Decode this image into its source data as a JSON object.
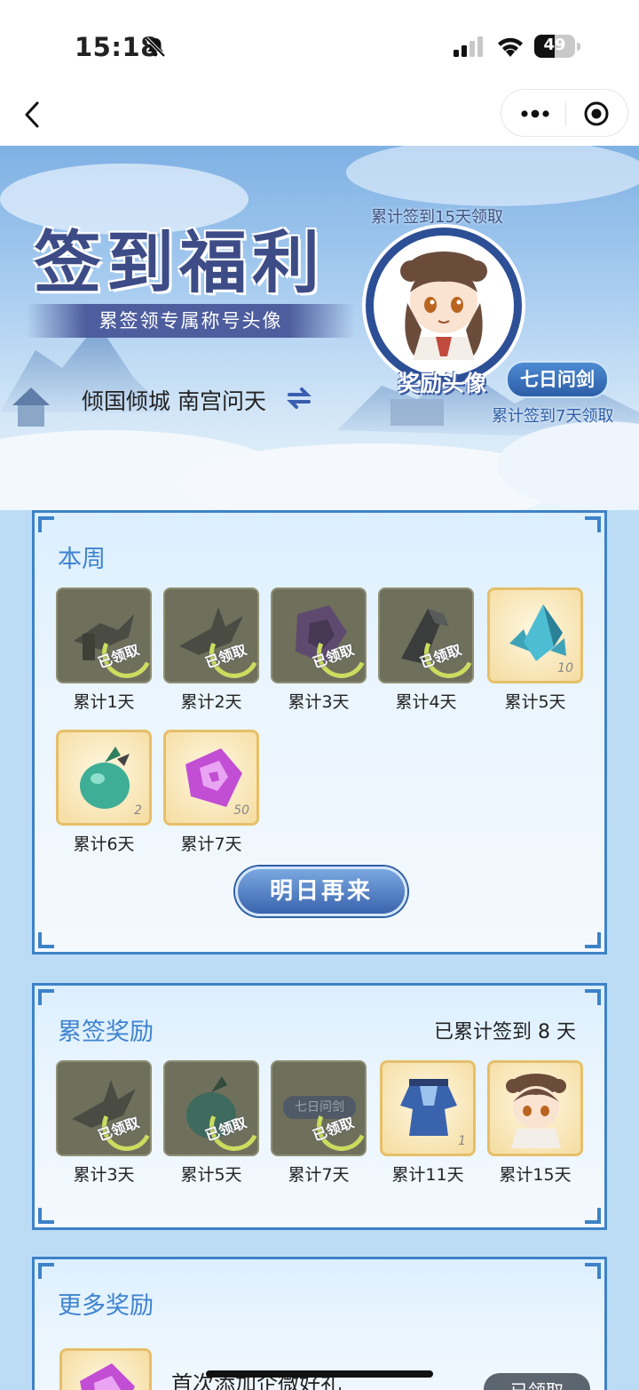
{
  "status_bar": {
    "time": "15:18",
    "battery": "49",
    "battery_level": 0.49
  },
  "hero": {
    "title": "签到福利",
    "subtitle": "累签领专属称号头像",
    "user_titles": "倾国倾城 南宫问天",
    "avatar_caption": "累计签到15天领取",
    "avatar_label": "奖励头像",
    "badge_label": "七日问剑",
    "badge_caption": "累计签到7天领取"
  },
  "weekly": {
    "title": "本周",
    "items": [
      {
        "label": "累计1天",
        "status": "已领取",
        "icon": "sword-hilt-icon"
      },
      {
        "label": "累计2天",
        "status": "已领取",
        "icon": "broken-blade-icon"
      },
      {
        "label": "累计3天",
        "status": "已领取",
        "icon": "rune-fragment-icon"
      },
      {
        "label": "累计4天",
        "status": "已领取",
        "icon": "iron-ore-icon"
      },
      {
        "label": "累计5天",
        "quantity": "10",
        "icon": "crystal-icon"
      },
      {
        "label": "累计6天",
        "quantity": "2",
        "icon": "jade-pouch-icon"
      },
      {
        "label": "累计7天",
        "quantity": "50",
        "icon": "purple-rune-icon"
      }
    ],
    "button": "明日再来"
  },
  "cumulative": {
    "title": "累签奖励",
    "summary": "已累计签到 8 天",
    "items": [
      {
        "label": "累计3天",
        "status": "已领取",
        "icon": "broken-blade-icon"
      },
      {
        "label": "累计5天",
        "status": "已领取",
        "icon": "jade-pouch-icon"
      },
      {
        "label": "累计7天",
        "status": "已领取",
        "icon": "title-plaque-icon",
        "plaque_text": "七日问剑"
      },
      {
        "label": "累计11天",
        "quantity": "1",
        "icon": "blue-robe-icon"
      },
      {
        "label": "累计15天",
        "icon": "avatar-portrait-icon"
      }
    ]
  },
  "more": {
    "title": "更多奖励",
    "item_title": "首次添加企微好礼",
    "item_button": "已领取"
  }
}
